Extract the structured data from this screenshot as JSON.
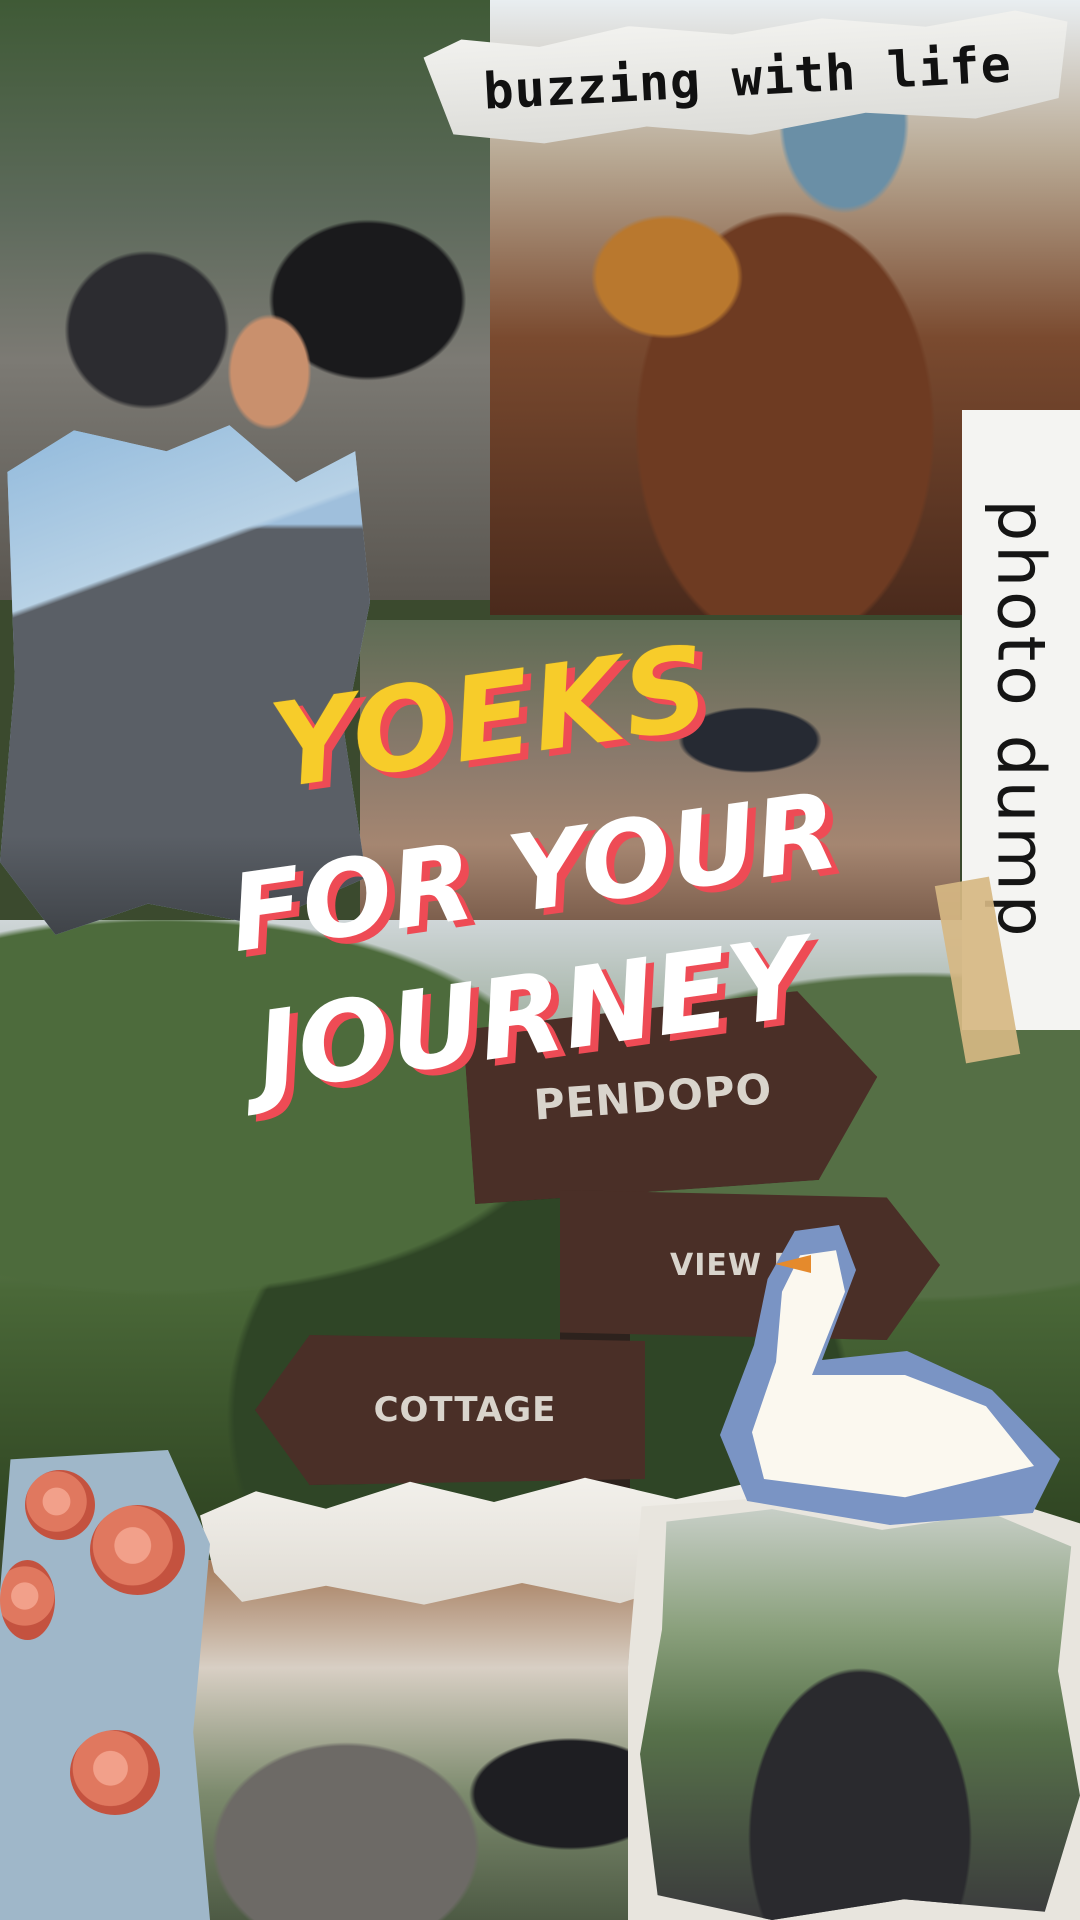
{
  "collage": {
    "sticker_top": "buzzing with life",
    "side_label": "photo dump",
    "headline_line1": "YOEKS",
    "headline_line2": "FOR YOUR",
    "headline_line3": "JOURNEY"
  },
  "signs": {
    "pendopo": "PENDOPO",
    "view": "VIEW M",
    "cottage": "COTTAGE"
  },
  "colors": {
    "headline_yellow": "#f7cc2a",
    "headline_red_shadow": "#ee4b55",
    "headline_white": "#ffffff",
    "sign_wood": "#4a2f27"
  }
}
